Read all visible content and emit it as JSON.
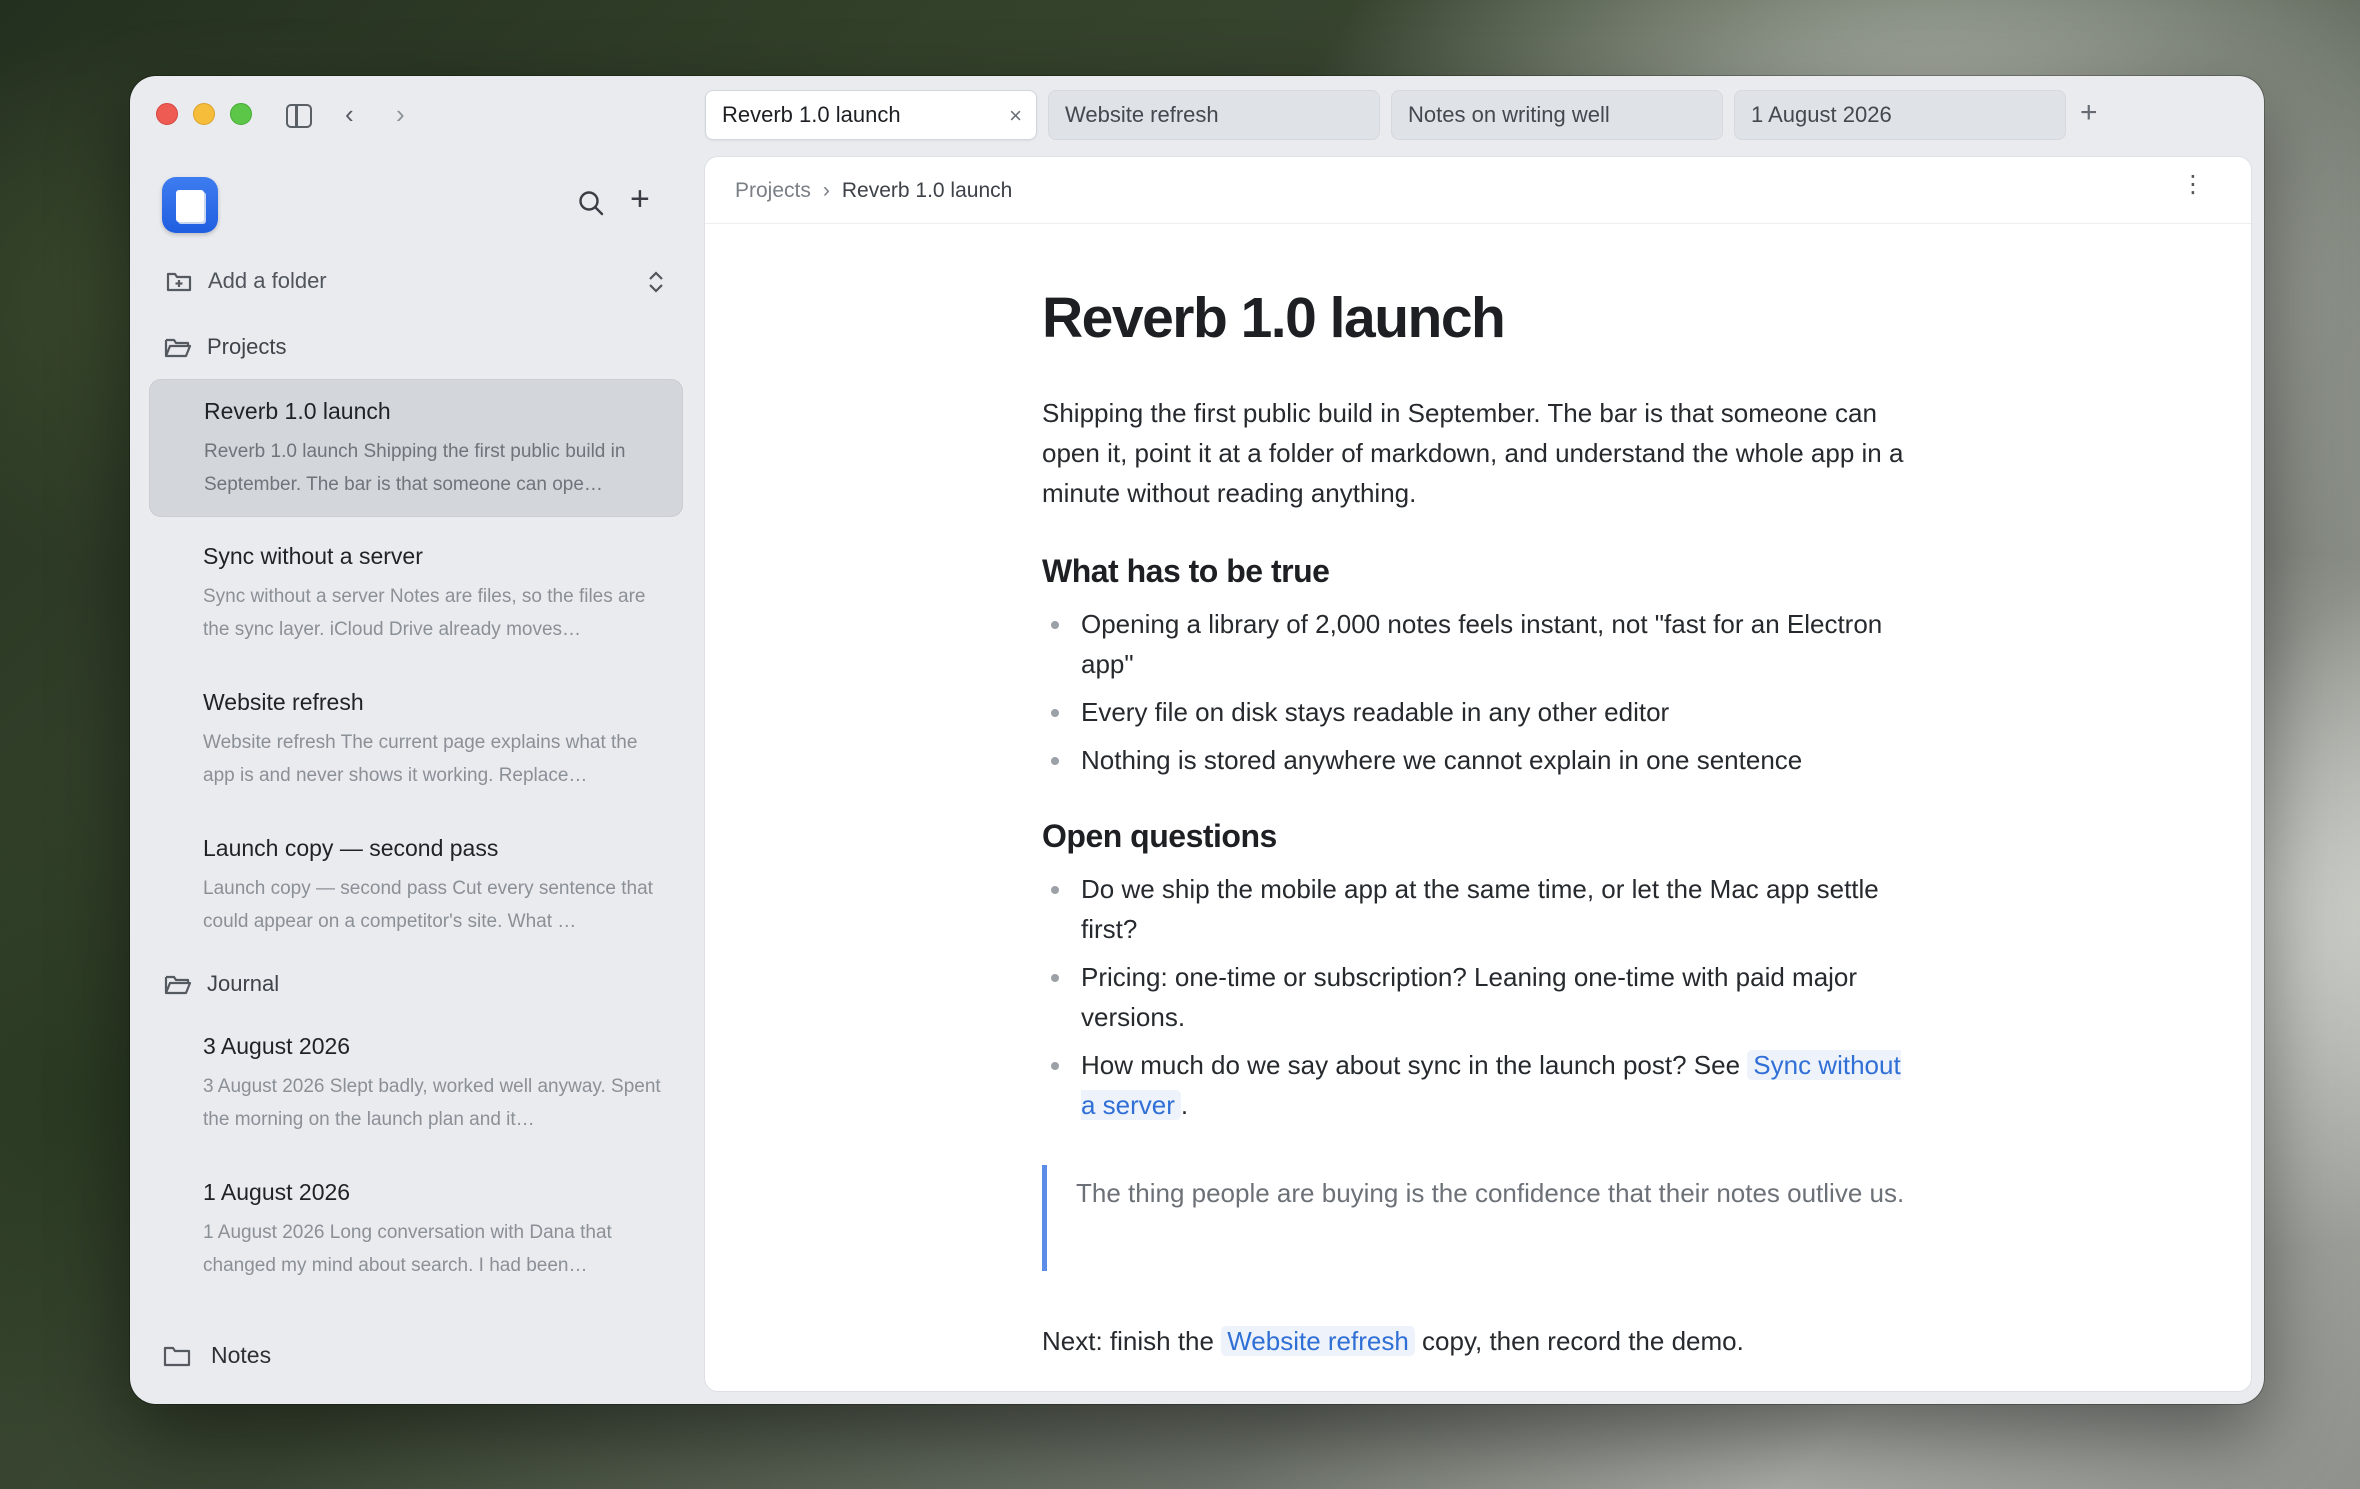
{
  "window": {
    "tabs": [
      {
        "label": "Reverb 1.0 launch",
        "active": true
      },
      {
        "label": "Website refresh",
        "active": false
      },
      {
        "label": "Notes on writing well",
        "active": false
      },
      {
        "label": "1 August 2026",
        "active": false
      }
    ],
    "tab_close": "×",
    "new_tab": "+",
    "nav_back": "‹",
    "nav_forward": "›"
  },
  "sidebar": {
    "plus": "+",
    "add_folder": "Add a folder",
    "chevrons": "⌃⌄",
    "folders": [
      {
        "name": "Projects",
        "notes": [
          {
            "title": "Reverb 1.0 launch",
            "snippet": "Reverb 1.0 launch Shipping the first public build in September. The bar is that someone can ope…",
            "selected": true
          },
          {
            "title": "Sync without a server",
            "snippet": "Sync without a server Notes are files, so the files are the sync layer. iCloud Drive already moves…",
            "selected": false
          },
          {
            "title": "Website refresh",
            "snippet": "Website refresh The current page explains what the app is and never shows it working. Replace…",
            "selected": false
          },
          {
            "title": "Launch copy — second pass",
            "snippet": "Launch copy — second pass Cut every sentence that could appear on a competitor's site. What …",
            "selected": false
          }
        ]
      },
      {
        "name": "Journal",
        "notes": [
          {
            "title": "3 August 2026",
            "snippet": "3 August 2026 Slept badly, worked well anyway. Spent the morning on the launch plan and it…",
            "selected": false
          },
          {
            "title": "1 August 2026",
            "snippet": "1 August 2026 Long conversation with Dana that changed my mind about search. I had been…",
            "selected": false
          }
        ]
      }
    ],
    "bottom_folder": "Notes"
  },
  "main": {
    "breadcrumb": {
      "parent": "Projects",
      "separator": "›",
      "current": "Reverb 1.0 launch"
    },
    "kebab": "⋮",
    "doc": {
      "title": "Reverb 1.0 launch",
      "lead": "Shipping the first public build in September. The bar is that someone can open it, point it at a folder of markdown, and understand the whole app in a minute without reading anything.",
      "section1": {
        "heading": "What has to be true",
        "items": [
          "Opening a library of 2,000 notes feels instant, not \"fast for an Electron app\"",
          "Every file on disk stays readable in any other editor",
          "Nothing is stored anywhere we cannot explain in one sentence"
        ]
      },
      "section2": {
        "heading": "Open questions",
        "items": [
          "Do we ship the mobile app at the same time, or let the Mac app settle first?",
          "Pricing: one-time or subscription? Leaning one-time with paid major versions."
        ],
        "last_item_prefix": "How much do we say about sync in the launch post? See ",
        "last_item_link": "Sync without a server",
        "last_item_suffix": "."
      },
      "quote": "The thing people are buying is the confidence that their notes outlive us.",
      "next_prefix": "Next: finish the ",
      "next_link": "Website refresh",
      "next_suffix": " copy, then record the demo."
    }
  }
}
